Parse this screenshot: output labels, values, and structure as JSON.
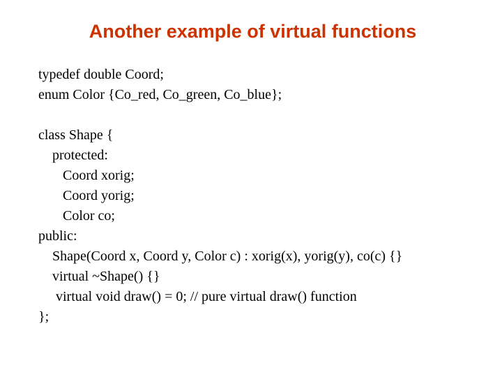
{
  "title": "Another example of virtual functions",
  "code": {
    "l1": "typedef double Coord;",
    "l2": "enum Color {Co_red, Co_green, Co_blue};",
    "l3": "",
    "l4": "class Shape {",
    "l5": "    protected:",
    "l6": "       Coord xorig;",
    "l7": "       Coord yorig;",
    "l8": "       Color co;",
    "l9": "public:",
    "l10": "    Shape(Coord x, Coord y, Color c) : xorig(x), yorig(y), co(c) {}",
    "l11": "    virtual ~Shape() {}",
    "l12": "     virtual void draw() = 0; // pure virtual draw() function",
    "l13": "};"
  }
}
